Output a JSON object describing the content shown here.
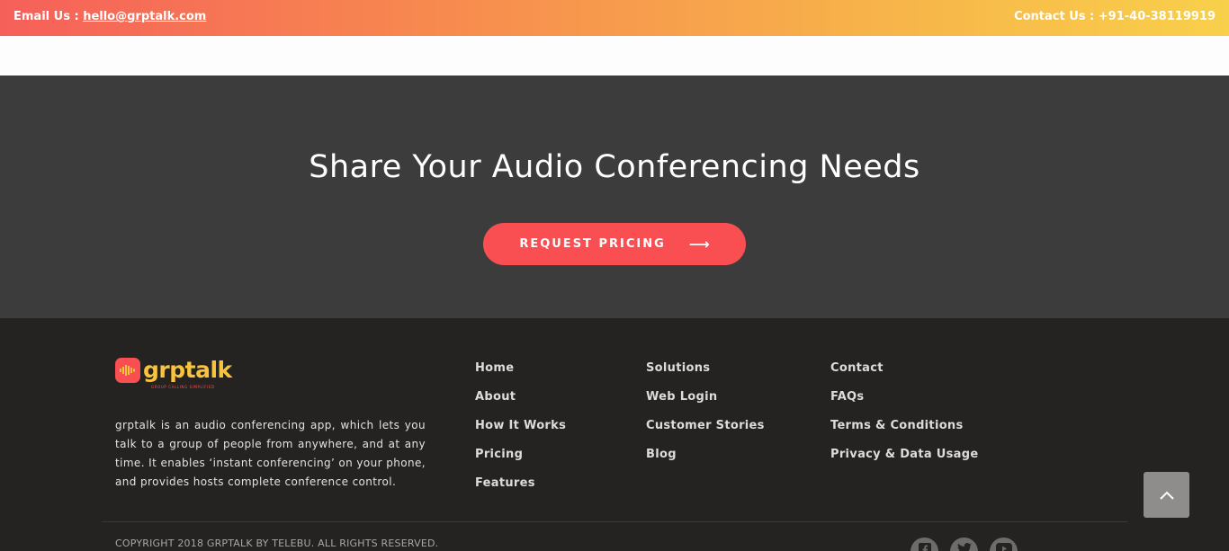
{
  "topbar": {
    "email_label": "Email Us : ",
    "email": "hello@grptalk.com",
    "contact": "Contact Us : +91-40-38119919"
  },
  "cta": {
    "heading": "Share Your Audio Conferencing Needs",
    "button_label": "REQUEST PRICING",
    "button_arrow": "⟶"
  },
  "footer": {
    "logo": {
      "wordmark": "grptalk",
      "tagline": "GROUP CALLING SIMPLIFIED"
    },
    "about": "grptalk is an audio conferencing app, which lets you talk to a group of people from anywhere, and at any time. It enables ‘instant conferencing’ on your phone, and provides hosts complete conference control.",
    "links_col1": [
      "Home",
      "About",
      "How It Works",
      "Pricing",
      "Features"
    ],
    "links_col2": [
      "Solutions",
      "Web Login",
      "Customer Stories",
      "Blog"
    ],
    "links_col3": [
      "Contact",
      "FAQs",
      "Terms & Conditions",
      "Privacy & Data Usage"
    ],
    "copyright": "COPYRIGHT 2018 GRPTALK BY TELEBU. ALL RIGHTS RESERVED.",
    "social_icons": [
      "facebook-icon",
      "twitter-icon",
      "youtube-icon"
    ]
  },
  "colors": {
    "accent": "#f94f53",
    "brand_yellow": "#f8c33d",
    "cta_bg": "#3c3c3c",
    "footer_bg": "#252322"
  },
  "icons": {
    "scroll_top": "chevron-up-icon"
  }
}
